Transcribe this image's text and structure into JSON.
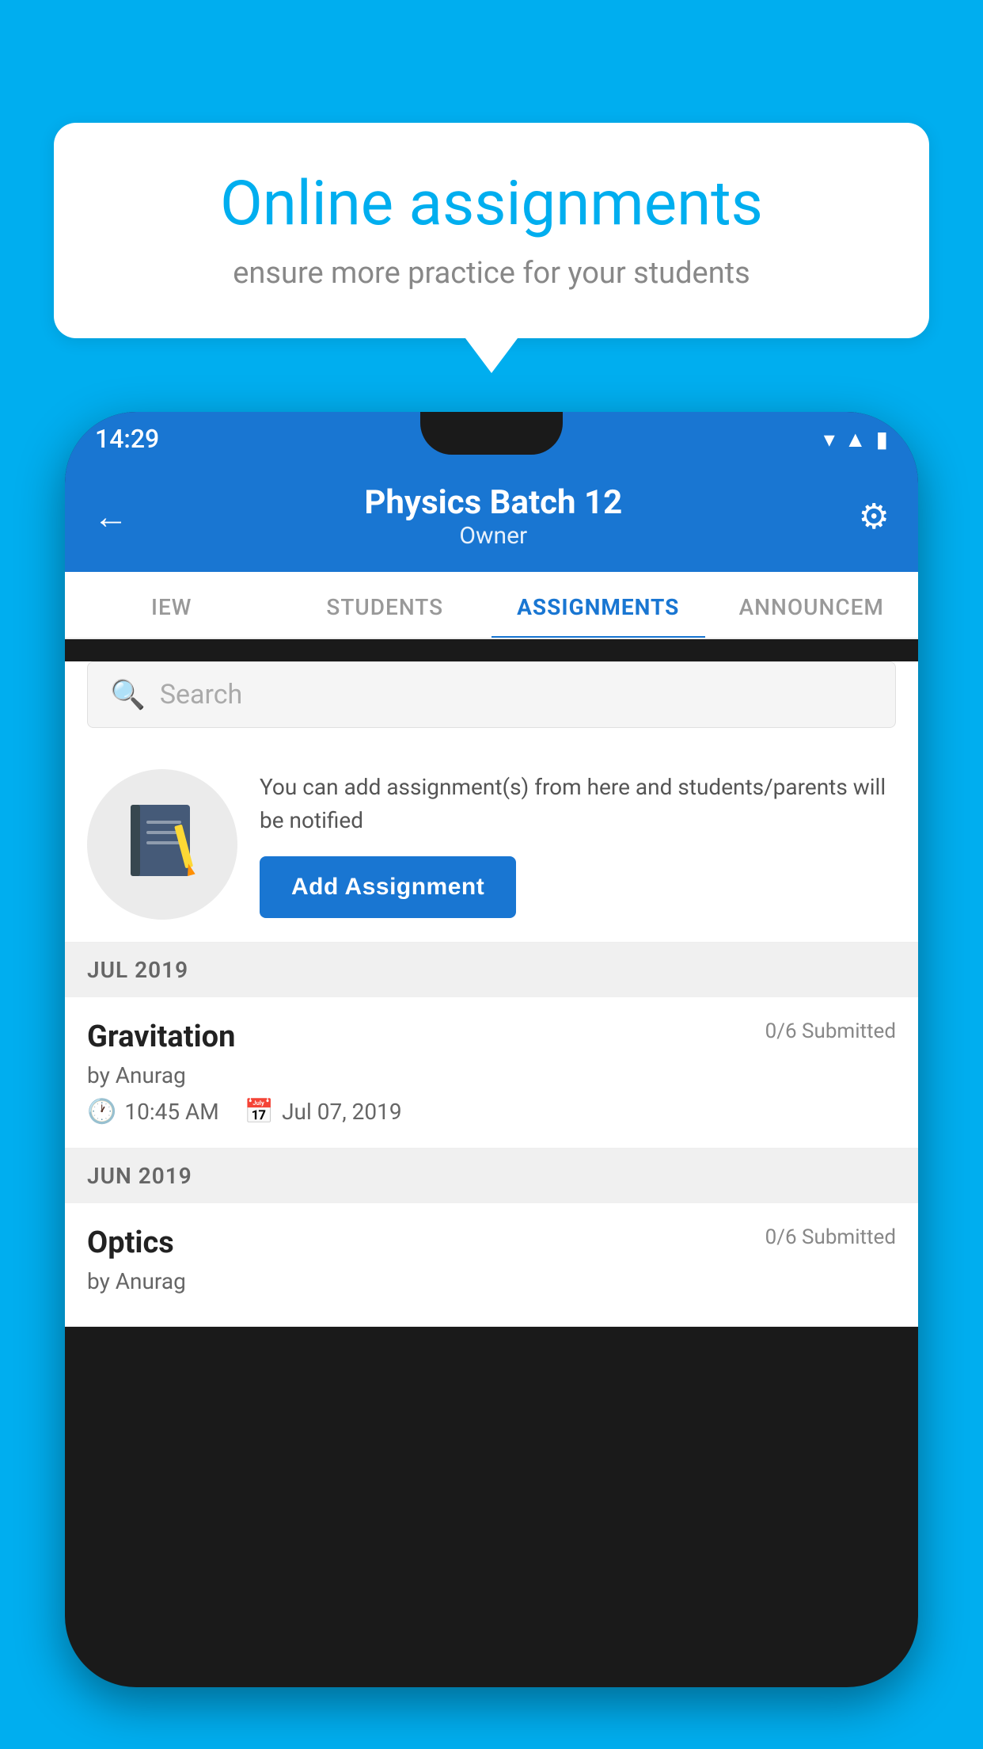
{
  "background_color": "#00AEEF",
  "speech_bubble": {
    "title": "Online assignments",
    "subtitle": "ensure more practice for your students"
  },
  "status_bar": {
    "time": "14:29",
    "icons": [
      "wifi",
      "signal",
      "battery"
    ]
  },
  "app_header": {
    "title": "Physics Batch 12",
    "subtitle": "Owner",
    "back_label": "←",
    "settings_label": "⚙"
  },
  "tabs": [
    {
      "label": "IEW",
      "active": false
    },
    {
      "label": "STUDENTS",
      "active": false
    },
    {
      "label": "ASSIGNMENTS",
      "active": true
    },
    {
      "label": "ANNOUNCEM",
      "active": false
    }
  ],
  "search": {
    "placeholder": "Search"
  },
  "promo": {
    "description": "You can add assignment(s) from here and students/parents will be notified",
    "button_label": "Add Assignment"
  },
  "months": [
    {
      "label": "JUL 2019",
      "assignments": [
        {
          "title": "Gravitation",
          "submitted": "0/6 Submitted",
          "author": "by Anurag",
          "time": "10:45 AM",
          "date": "Jul 07, 2019"
        }
      ]
    },
    {
      "label": "JUN 2019",
      "assignments": [
        {
          "title": "Optics",
          "submitted": "0/6 Submitted",
          "author": "by Anurag",
          "time": "",
          "date": ""
        }
      ]
    }
  ]
}
